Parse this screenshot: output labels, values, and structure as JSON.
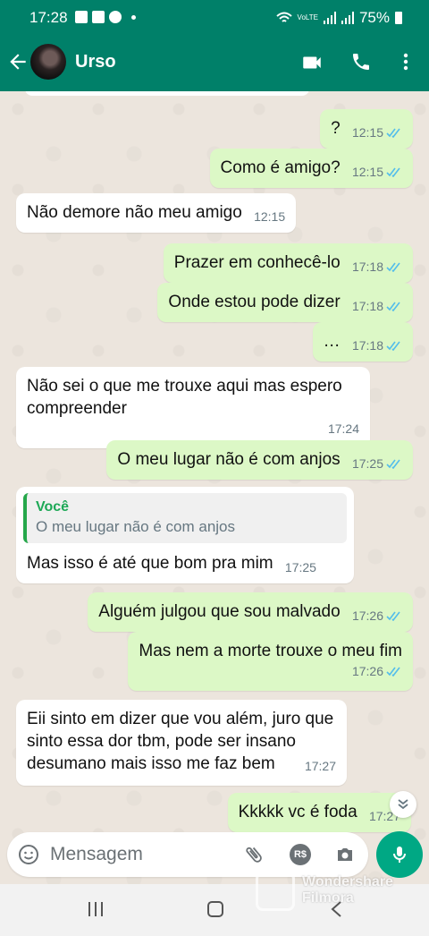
{
  "status": {
    "time": "17:28",
    "net_label": "VoLTE",
    "battery": "75%"
  },
  "header": {
    "contact_name": "Urso"
  },
  "messages": [
    {
      "dir": "out",
      "text": "?",
      "time": "12:15"
    },
    {
      "dir": "out",
      "text": "Como é amigo?",
      "time": "12:15"
    },
    {
      "dir": "in",
      "text": "Não demore não meu amigo",
      "time": "12:15"
    },
    {
      "dir": "out",
      "text": "Prazer em conhecê-lo",
      "time": "17:18"
    },
    {
      "dir": "out",
      "text": "Onde estou pode dizer",
      "time": "17:18"
    },
    {
      "dir": "out",
      "text": "…",
      "time": "17:18"
    },
    {
      "dir": "in",
      "text": "Não sei o que me trouxe aqui mas espero compreender",
      "time": "17:24"
    },
    {
      "dir": "out",
      "text": "O meu lugar não é com anjos",
      "time": "17:25"
    },
    {
      "dir": "in",
      "text": "Mas isso é até que bom pra mim",
      "time": "17:25",
      "quote_author": "Você",
      "quote_text": "O meu lugar não é com anjos"
    },
    {
      "dir": "out",
      "text": "Alguém julgou que sou malvado",
      "time": "17:26"
    },
    {
      "dir": "out",
      "text": "Mas nem a morte trouxe o meu fim",
      "time": "17:26"
    },
    {
      "dir": "in",
      "text": "Eii sinto em dizer que vou além, juro que sinto essa dor tbm, pode ser insano desumano mais isso me faz bem",
      "time": "17:27"
    },
    {
      "dir": "out",
      "text": "Kkkkk vc é foda",
      "time": "17:27"
    }
  ],
  "composer": {
    "placeholder": "Mensagem",
    "pay_label": "R$"
  },
  "watermark": {
    "line1": "Wondershare",
    "line2": "Filmora"
  },
  "colors": {
    "header_green": "#008069",
    "out_bubble": "#dcf8c6",
    "in_bubble": "#ffffff",
    "read_tick": "#53bdeb",
    "mic_green": "#00a884"
  }
}
